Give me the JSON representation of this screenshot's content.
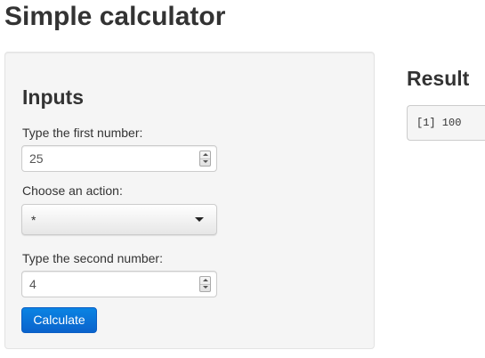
{
  "page": {
    "title": "Simple calculator"
  },
  "inputs": {
    "heading": "Inputs",
    "first_number": {
      "label": "Type the first number:",
      "value": "25"
    },
    "action": {
      "label": "Choose an action:",
      "selected": "*"
    },
    "second_number": {
      "label": "Type the second number:",
      "value": "4"
    },
    "calculate_label": "Calculate"
  },
  "result": {
    "heading": "Result",
    "output": "[1] 100"
  },
  "colors": {
    "button": "#0a6fd8",
    "panel": "#f5f5f5"
  }
}
